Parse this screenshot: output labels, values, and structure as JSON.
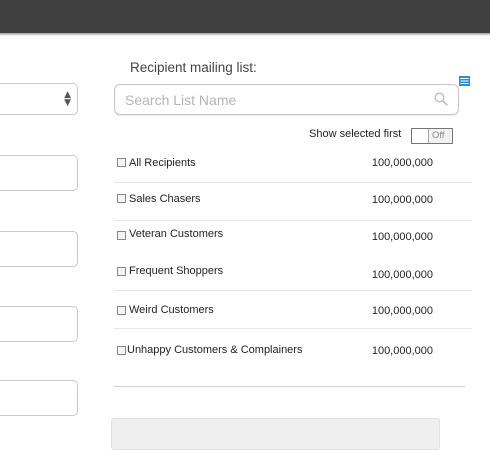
{
  "form": {
    "section_title": "Recipient mailing list:"
  },
  "search": {
    "placeholder": "Search List Name",
    "value": ""
  },
  "filter": {
    "show_selected_label": "Show selected first",
    "toggle_state": "Off"
  },
  "lists": [
    {
      "name": "All Recipients",
      "count": "100,000,000",
      "checked": false
    },
    {
      "name": "Sales Chasers",
      "count": "100,000,000",
      "checked": false
    },
    {
      "name": "Veteran Customers",
      "count": "100,000,000",
      "checked": false
    },
    {
      "name": " Frequent Shoppers",
      "count": "100,000,000",
      "checked": false
    },
    {
      "name": "Weird Customers",
      "count": "100,000,000",
      "checked": false
    },
    {
      "name": "Unhappy Customers & Complainers",
      "count": "100,000,000",
      "checked": false
    }
  ],
  "icons": {
    "list_view": "list-view-icon",
    "search": "magnifier-icon",
    "select_arrows": "updown-arrows-icon"
  },
  "colors": {
    "topbar": "#3f3f3f",
    "accent": "#2b8fd6"
  }
}
